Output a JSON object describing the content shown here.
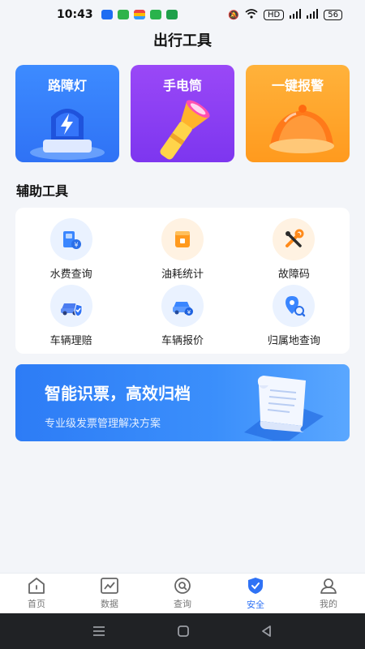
{
  "status_bar": {
    "time": "10:43",
    "hd": "HD",
    "battery": "56"
  },
  "page_title": "出行工具",
  "top_cards": [
    {
      "label": "路障灯",
      "icon": "roadblock-light-icon",
      "color": "#3d8bff"
    },
    {
      "label": "手电筒",
      "icon": "flashlight-icon",
      "color": "#9a48f7"
    },
    {
      "label": "一键报警",
      "icon": "alarm-bell-icon",
      "color": "#ffb23b"
    }
  ],
  "section_title": "辅助工具",
  "tools": [
    {
      "label": "水费查询",
      "icon": "water-fee-icon"
    },
    {
      "label": "油耗统计",
      "icon": "fuel-stats-icon"
    },
    {
      "label": "故障码",
      "icon": "fault-code-icon"
    },
    {
      "label": "车辆理赔",
      "icon": "car-claim-icon"
    },
    {
      "label": "车辆报价",
      "icon": "car-quote-icon"
    },
    {
      "label": "归属地查询",
      "icon": "location-lookup-icon"
    }
  ],
  "banner": {
    "title": "智能识票，高效归档",
    "subtitle": "专业级发票管理解决方案"
  },
  "bottom_nav": [
    {
      "label": "首页",
      "icon": "home-icon",
      "active": false
    },
    {
      "label": "数据",
      "icon": "chart-icon",
      "active": false
    },
    {
      "label": "查询",
      "icon": "search-icon",
      "active": false
    },
    {
      "label": "安全",
      "icon": "shield-icon",
      "active": true
    },
    {
      "label": "我的",
      "icon": "user-icon",
      "active": false
    }
  ],
  "colors": {
    "accent": "#2f72f5",
    "background": "#f3f5f9"
  }
}
